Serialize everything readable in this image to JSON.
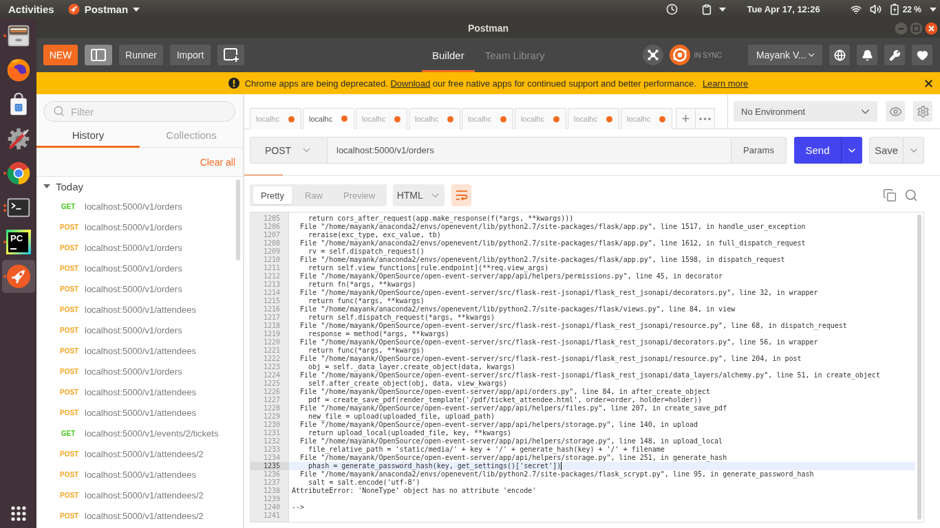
{
  "top_bar": {
    "activities": "Activities",
    "app_menu": "Postman",
    "date_time": "Tue Apr 17, 12:26",
    "battery": "22 %"
  },
  "dock": {
    "items": [
      {
        "kind": "files",
        "running": true,
        "multiple": false,
        "active": false
      },
      {
        "kind": "fox",
        "running": false,
        "multiple": false,
        "active": false
      },
      {
        "kind": "store",
        "running": false,
        "multiple": false,
        "active": false
      },
      {
        "kind": "tools",
        "running": false,
        "multiple": false,
        "active": false
      },
      {
        "kind": "ring",
        "running": true,
        "multiple": false,
        "active": false
      },
      {
        "kind": "terminal",
        "running": true,
        "multiple": true,
        "active": false
      },
      {
        "kind": "ide",
        "label": "PC",
        "running": true,
        "multiple": false,
        "active": false
      },
      {
        "kind": "rocket",
        "running": true,
        "multiple": false,
        "active": true
      }
    ]
  },
  "window": {
    "title": "Postman"
  },
  "toolbar": {
    "new_button": "NEW",
    "sidebar_toggle": {
      "on": true
    },
    "runner_button": "Runner",
    "import_button": "Import",
    "views": [
      {
        "label": "Builder",
        "selected": true
      },
      {
        "label": "Team Library",
        "selected": false
      }
    ],
    "sync_status": "IN SYNC",
    "account": "Mayank V..."
  },
  "banner": {
    "message_start": "Chrome apps are being deprecated.",
    "download_link": "Download",
    "message_end": "our free native apps for continued support and better performance.",
    "learn_more_link": "Learn more"
  },
  "sidebar": {
    "filter": {
      "placeholder": "Filter"
    },
    "tabs": [
      {
        "label": "History",
        "selected": true
      },
      {
        "label": "Collections",
        "selected": false
      }
    ],
    "clear_all": "Clear all",
    "groups": [
      {
        "label": "Today",
        "expanded": true,
        "items": [
          {
            "method": "GET",
            "color": "#49c91e",
            "url": "localhost:5000/v1/orders"
          },
          {
            "method": "POST",
            "color": "#f5a623",
            "url": "localhost:5000/v1/orders"
          },
          {
            "method": "POST",
            "color": "#f5a623",
            "url": "localhost:5000/v1/orders"
          },
          {
            "method": "POST",
            "color": "#f5a623",
            "url": "localhost:5000/v1/orders"
          },
          {
            "method": "POST",
            "color": "#f5a623",
            "url": "localhost:5000/v1/orders"
          },
          {
            "method": "POST",
            "color": "#f5a623",
            "url": "localhost:5000/v1/attendees"
          },
          {
            "method": "POST",
            "color": "#f5a623",
            "url": "localhost:5000/v1/orders"
          },
          {
            "method": "POST",
            "color": "#f5a623",
            "url": "localhost:5000/v1/attendees"
          },
          {
            "method": "POST",
            "color": "#f5a623",
            "url": "localhost:5000/v1/orders"
          },
          {
            "method": "POST",
            "color": "#f5a623",
            "url": "localhost:5000/v1/attendees"
          },
          {
            "method": "POST",
            "color": "#f5a623",
            "url": "localhost:5000/v1/attendees"
          },
          {
            "method": "GET",
            "color": "#49c91e",
            "url": "localhost:5000/v1/events/2/tickets"
          },
          {
            "method": "POST",
            "color": "#f5a623",
            "url": "localhost:5000/v1/attendees/2"
          },
          {
            "method": "POST",
            "color": "#f5a623",
            "url": "localhost:5000/v1/attendees"
          },
          {
            "method": "POST",
            "color": "#f5a623",
            "url": "localhost:5000/v1/attendees/2"
          },
          {
            "method": "POST",
            "color": "#f5a623",
            "url": "localhost:5000/v1/attendees/2"
          }
        ]
      }
    ]
  },
  "request_tabs": [
    {
      "label": "localhc",
      "selected": false,
      "unsaved": true
    },
    {
      "label": "localhc",
      "selected": true,
      "unsaved": true
    },
    {
      "label": "localhc",
      "selected": false,
      "unsaved": true
    },
    {
      "label": "localhc",
      "selected": false,
      "unsaved": true
    },
    {
      "label": "localhc",
      "selected": false,
      "unsaved": true
    },
    {
      "label": "localhc",
      "selected": false,
      "unsaved": true
    },
    {
      "label": "localhc",
      "selected": false,
      "unsaved": true
    },
    {
      "label": "localhc",
      "selected": false,
      "unsaved": true
    }
  ],
  "environment": {
    "value": "No Environment"
  },
  "request": {
    "method": "POST",
    "url": "localhost:5000/v1/orders",
    "params_button": "Params",
    "send_button": "Send",
    "save_button": "Save"
  },
  "response": {
    "formats": [
      {
        "label": "Pretty",
        "selected": true
      },
      {
        "label": "Raw",
        "selected": false
      },
      {
        "label": "Preview",
        "selected": false
      }
    ],
    "language": "HTML",
    "wrap_lines": {
      "on": true
    },
    "lines": [
      {
        "number": "1205",
        "text": "    return cors_after_request(app.make_response(f(*args, **kwargs)))",
        "highlighted": false
      },
      {
        "number": "1206",
        "text": "  File \"/home/mayank/anaconda2/envs/openevent/lib/python2.7/site-packages/flask/app.py\", line 1517, in handle_user_exception",
        "highlighted": false
      },
      {
        "number": "1207",
        "text": "    reraise(exc_type, exc_value, tb)",
        "highlighted": false
      },
      {
        "number": "1208",
        "text": "  File \"/home/mayank/anaconda2/envs/openevent/lib/python2.7/site-packages/flask/app.py\", line 1612, in full_dispatch_request",
        "highlighted": false
      },
      {
        "number": "1209",
        "text": "    rv = self.dispatch_request()",
        "highlighted": false
      },
      {
        "number": "1210",
        "text": "  File \"/home/mayank/anaconda2/envs/openevent/lib/python2.7/site-packages/flask/app.py\", line 1598, in dispatch_request",
        "highlighted": false
      },
      {
        "number": "1211",
        "text": "    return self.view_functions[rule.endpoint](**req.view_args)",
        "highlighted": false
      },
      {
        "number": "1212",
        "text": "  File \"/home/mayank/OpenSource/open-event-server/app/api/helpers/permissions.py\", line 45, in decorator",
        "highlighted": false
      },
      {
        "number": "1213",
        "text": "    return fn(*args, **kwargs)",
        "highlighted": false
      },
      {
        "number": "1214",
        "text": "  File \"/home/mayank/OpenSource/open-event-server/src/flask-rest-jsonapi/flask_rest_jsonapi/decorators.py\", line 32, in wrapper",
        "highlighted": false
      },
      {
        "number": "1215",
        "text": "    return func(*args, **kwargs)",
        "highlighted": false
      },
      {
        "number": "1216",
        "text": "  File \"/home/mayank/anaconda2/envs/openevent/lib/python2.7/site-packages/flask/views.py\", line 84, in view",
        "highlighted": false
      },
      {
        "number": "1217",
        "text": "    return self.dispatch_request(*args, **kwargs)",
        "highlighted": false
      },
      {
        "number": "1218",
        "text": "  File \"/home/mayank/OpenSource/open-event-server/src/flask-rest-jsonapi/flask_rest_jsonapi/resource.py\", line 68, in dispatch_request",
        "highlighted": false
      },
      {
        "number": "1219",
        "text": "    response = method(*args, **kwargs)",
        "highlighted": false
      },
      {
        "number": "1220",
        "text": "  File \"/home/mayank/OpenSource/open-event-server/src/flask-rest-jsonapi/flask_rest_jsonapi/decorators.py\", line 56, in wrapper",
        "highlighted": false
      },
      {
        "number": "1221",
        "text": "    return func(*args, **kwargs)",
        "highlighted": false
      },
      {
        "number": "1222",
        "text": "  File \"/home/mayank/OpenSource/open-event-server/src/flask-rest-jsonapi/flask_rest_jsonapi/resource.py\", line 204, in post",
        "highlighted": false
      },
      {
        "number": "1223",
        "text": "    obj = self._data_layer.create_object(data, kwargs)",
        "highlighted": false
      },
      {
        "number": "1224",
        "text": "  File \"/home/mayank/OpenSource/open-event-server/src/flask-rest-jsonapi/flask_rest_jsonapi/data_layers/alchemy.py\", line 51, in create_object",
        "highlighted": false
      },
      {
        "number": "1225",
        "text": "    self.after_create_object(obj, data, view_kwargs)",
        "highlighted": false
      },
      {
        "number": "1226",
        "text": "  File \"/home/mayank/OpenSource/open-event-server/app/api/orders.py\", line 84, in after_create_object",
        "highlighted": false
      },
      {
        "number": "1227",
        "text": "    pdf = create_save_pdf(render_template('/pdf/ticket_attendee.html', order=order, holder=holder))",
        "highlighted": false
      },
      {
        "number": "1228",
        "text": "  File \"/home/mayank/OpenSource/open-event-server/app/api/helpers/files.py\", line 207, in create_save_pdf",
        "highlighted": false
      },
      {
        "number": "1229",
        "text": "    new_file = upload(uploaded_file, upload_path)",
        "highlighted": false
      },
      {
        "number": "1230",
        "text": "  File \"/home/mayank/OpenSource/open-event-server/app/api/helpers/storage.py\", line 140, in upload",
        "highlighted": false
      },
      {
        "number": "1231",
        "text": "    return upload_local(uploaded_file, key, **kwargs)",
        "highlighted": false
      },
      {
        "number": "1232",
        "text": "  File \"/home/mayank/OpenSource/open-event-server/app/api/helpers/storage.py\", line 148, in upload_local",
        "highlighted": false
      },
      {
        "number": "1233",
        "text": "    file_relative_path = 'static/media/' + key + '/' + generate_hash(key) + '/' + filename",
        "highlighted": false
      },
      {
        "number": "1234",
        "text": "  File \"/home/mayank/OpenSource/open-event-server/app/api/helpers/storage.py\", line 251, in generate_hash",
        "highlighted": false
      },
      {
        "number": "1235",
        "text": "    phash = generate_password_hash(key, get_settings()['secret'])",
        "highlighted": true
      },
      {
        "number": "1236",
        "text": "  File \"/home/mayank/anaconda2/envs/openevent/lib/python2.7/site-packages/flask_scrypt.py\", line 95, in generate_password_hash",
        "highlighted": false
      },
      {
        "number": "1237",
        "text": "    salt = salt.encode('utf-8')",
        "highlighted": false
      },
      {
        "number": "1238",
        "text": "AttributeError: 'NoneType' object has no attribute 'encode'",
        "highlighted": false
      },
      {
        "number": "1239",
        "highlighted": false
      },
      {
        "number": "1240",
        "text": "-->",
        "highlighted": false
      },
      {
        "number": "1241",
        "highlighted": false
      }
    ]
  }
}
